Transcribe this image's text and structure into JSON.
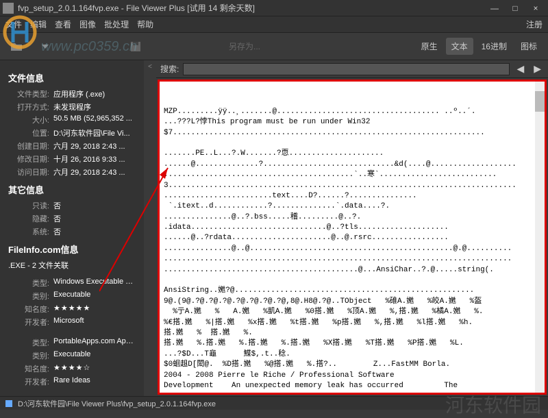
{
  "window": {
    "title": "fvp_setup_2.0.1.164fvp.exe - File Viewer Plus [试用 14 剩余天数]",
    "minimize": "—",
    "maximize": "□",
    "close": "×"
  },
  "menu": {
    "file": "文件",
    "edit": "编辑",
    "view": "查看",
    "image": "图像",
    "batch": "批处理",
    "help": "帮助",
    "register": "注册"
  },
  "toolbar": {
    "watermark": "www.pc0359.cn",
    "saveas": "另存为...",
    "modes": {
      "raw": "原生",
      "text": "文本",
      "hex": "16进制",
      "icon": "图标"
    }
  },
  "sidebar": {
    "fileinfo": {
      "header": "文件信息",
      "rows": [
        {
          "label": "文件类型:",
          "value": "应用程序 (.exe)"
        },
        {
          "label": "打开方式:",
          "value": "未发现程序"
        },
        {
          "label": "大小:",
          "value": "50.5 MB (52,965,352 ..."
        },
        {
          "label": "位置:",
          "value": "D:\\河东软件园\\File Vi..."
        },
        {
          "label": "创建日期:",
          "value": "六月 29, 2018 2:43 ..."
        },
        {
          "label": "修改日期:",
          "value": "十月 26, 2016 9:33 ..."
        },
        {
          "label": "访问日期:",
          "value": "六月 29, 2018 2:43 ..."
        }
      ]
    },
    "otherinfo": {
      "header": "其它信息",
      "rows": [
        {
          "label": "只读:",
          "value": "否"
        },
        {
          "label": "隐藏:",
          "value": "否"
        },
        {
          "label": "系统:",
          "value": "否"
        }
      ]
    },
    "fileinfodotcom": {
      "header": "FileInfo.com信息",
      "sub": ".EXE - 2 文件关联",
      "rows1": [
        {
          "label": "类型:",
          "value": "Windows Executable File"
        },
        {
          "label": "类别:",
          "value": "Executable"
        },
        {
          "label": "知名度:",
          "value": "★★★★★"
        },
        {
          "label": "开发者:",
          "value": "Microsoft"
        }
      ],
      "rows2": [
        {
          "label": "类型:",
          "value": "PortableApps.com App..."
        },
        {
          "label": "类别:",
          "value": "Executable"
        },
        {
          "label": "知名度:",
          "value": "★★★★☆"
        },
        {
          "label": "开发者:",
          "value": "Rare Ideas"
        }
      ]
    }
  },
  "search": {
    "label": "搜索:",
    "value": ""
  },
  "content_lines": [
    "MZP.........ÿÿ..¸.......@.................................... ..º..´.",
    "...???L?悖This program must be run under Win32",
    "$7.....................................................................",
    "",
    ".......PE..L...?.W.......?恧.....................",
    "......@..............?.............................&d(....@...................",
    "..........................................`..寒`..........................",
    "3.............................................................................",
    "........................text....D?......?...............",
    " `.itext..d............?..............`.data....?.",
    "...............@..?.bss.....稽.........@..?.",
    ".idata..............................@..?tls....................",
    "......@..?rdata......................@..@.rsrc.................",
    "...............@..@.............................................@.@..........",
    ".............................................................................",
    "...........................................@...AnsiChar..?.@.....string(.",
    "",
    "AnsiString..嬎?@.....................................................",
    "9@.(9@.?@.?@.?@.?@.?@.?@.?@,8@.H8@.?@..TObject   %碓A.嬎   %皎A.嬎   %盔",
    "  %亍A.嬎   %   A.嬎   %凱A.嬎   %0搭.嬎   %顶A.嬎   %,搭.嬎   %橘A.嬎   %.",
    "%€搭.嬎   %|搭.嬎   %x搭.嬎   %t搭.嬎   %p搭.嬎   %,搭.嬎   %l搭.嬎   %h.",
    "搭.嬎   %  搭.嬎   %.",
    "搭.嬎   %.搭.嬎   %.搭.嬎   %.搭.嬎   %X搭.嬎   %T搭.嬎   %P搭.嬎   %L.",
    "...?$D...T龜      鰈$,.t..稔.",
    "$0蛔趄D[閎@.  %D搭.嬎   %@搭.嬎   %.搭?..        Z...FastMM Borla.",
    "2004 - 2008 Pierre le Riche / Professional Software",
    "Development    An unexpected memory leak has occurred         The"
  ],
  "statusbar": {
    "path": "D:\\河东软件园\\File Viewer Plus\\fvp_setup_2.0.1.164fvp.exe"
  },
  "watermark_big": "河东软件园"
}
